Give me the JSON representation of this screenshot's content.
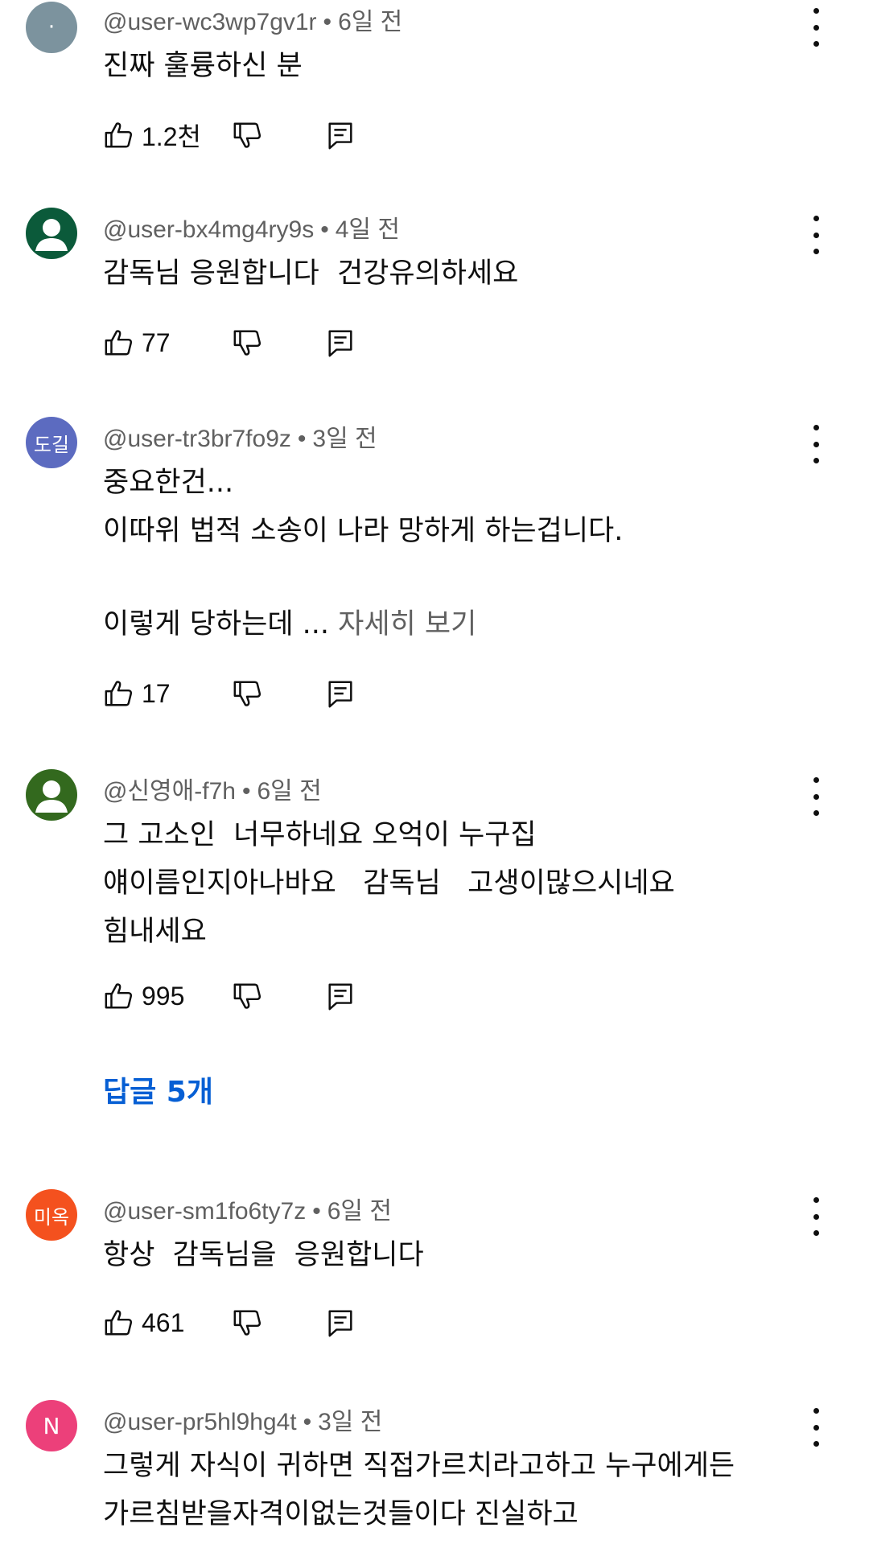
{
  "comments": [
    {
      "avatar_text": "·",
      "avatar_color": "#7c939e",
      "handle": "@user-wc3wp7gv1r",
      "time": "6일 전",
      "lines": [
        "진짜 훌륭하신 분"
      ],
      "likes": "1.2천"
    },
    {
      "avatar_text": "",
      "avatar_color": "#0b5a3a",
      "handle": "@user-bx4mg4ry9s",
      "time": "4일 전",
      "lines": [
        "감독님 응원합니다  건강유의하세요"
      ],
      "likes": "77"
    },
    {
      "avatar_text": "도길",
      "avatar_color": "#5c6bc0",
      "handle": "@user-tr3br7fo9z",
      "time": "3일 전",
      "lines": [
        "중요한건...",
        "이따위 법적 소송이 나라 망하게 하는겁니다.",
        "",
        "이렇게 당하는데 ... "
      ],
      "read_more": "자세히 보기",
      "likes": "17"
    },
    {
      "avatar_text": "",
      "avatar_color": "#33691e",
      "handle": "@신영애-f7h",
      "time": "6일 전",
      "lines": [
        "그 고소인  너무하네요 오억이 누구집",
        "얘이름인지아나바요   감독님   고생이많으시네요",
        "힘내세요"
      ],
      "likes": "995",
      "replies_label": "답글 5개"
    },
    {
      "avatar_text": "미옥",
      "avatar_color": "#f4511e",
      "handle": "@user-sm1fo6ty7z",
      "time": "6일 전",
      "lines": [
        "항상  감독님을  응원합니다"
      ],
      "likes": "461"
    },
    {
      "avatar_text": "N",
      "avatar_color": "#ec407a",
      "handle": "@user-pr5hl9hg4t",
      "time": "3일 전",
      "lines": [
        "그렇게 자식이 귀하면 직접가르치라고하고 누구에게든",
        "가르침받을자격이없는것들이다 진실하고"
      ]
    }
  ],
  "colors": {
    "link": "#065fd4",
    "meta": "#606060",
    "text": "#0f0f0f"
  },
  "icons": {
    "like": "thumb-up-icon",
    "dislike": "thumb-down-icon",
    "reply": "reply-icon",
    "menu": "more-vert-icon"
  }
}
